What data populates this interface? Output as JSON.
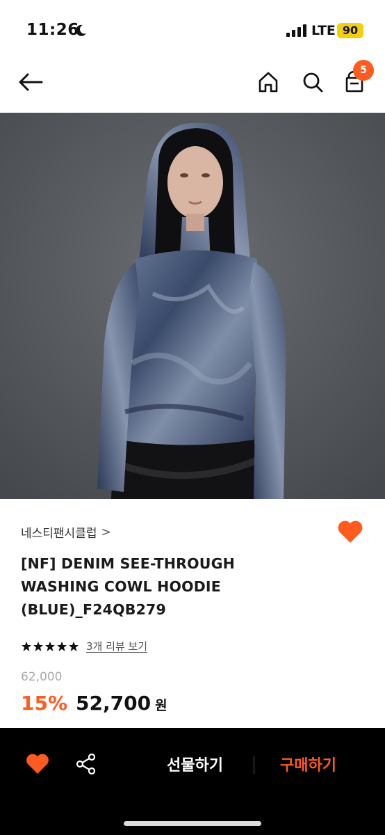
{
  "status_bar": {
    "time": "11:26",
    "network": "LTE",
    "battery": "90"
  },
  "header": {
    "cart_count": "5",
    "icons": [
      "back-arrow-icon",
      "home-icon",
      "search-icon",
      "shopping-bag-icon"
    ]
  },
  "product": {
    "brand": "네스티팬시클럽",
    "brand_chevron": ">",
    "title": "[NF] DENIM SEE-THROUGH WASHING COWL HOODIE (BLUE)_F24QB279",
    "rating_stars": 5,
    "review_link": "3개 리뷰 보기",
    "original_price": "62,000",
    "discount": "15%",
    "sale_price": "52,700",
    "currency": "원"
  },
  "bottom_bar": {
    "gift_label": "선물하기",
    "buy_label": "구매하기"
  },
  "colors": {
    "accent": "#ff5a1f",
    "battery": "#f3cf0c",
    "bottom_bar_bg": "#000000"
  }
}
